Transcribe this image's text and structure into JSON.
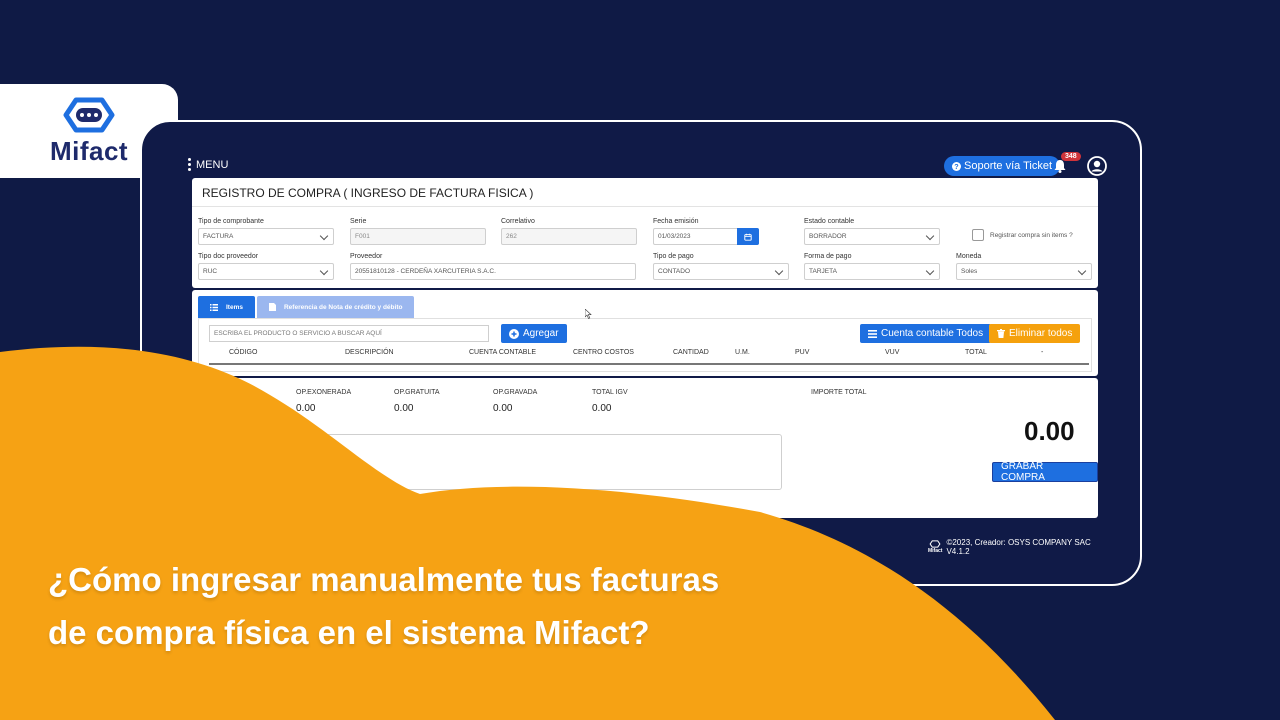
{
  "brand": {
    "name": "Mifact"
  },
  "topbar": {
    "menu_label": "MENU",
    "ticket_label": "Soporte vía Ticket",
    "notifications_count": "348"
  },
  "form": {
    "title": "REGISTRO DE COMPRA ( INGRESO DE FACTURA FISICA )",
    "tipo_comprobante": {
      "label": "Tipo de comprobante",
      "value": "FACTURA"
    },
    "serie": {
      "label": "Serie",
      "value": "F001"
    },
    "correlativo": {
      "label": "Correlativo",
      "value": "262"
    },
    "fecha_emision": {
      "label": "Fecha emisión",
      "value": "01/03/2023"
    },
    "estado_contable": {
      "label": "Estado contable",
      "value": "BORRADOR"
    },
    "registrar_sin_items": {
      "label": "Registrar compra sin items ?"
    },
    "tipo_doc_proveedor": {
      "label": "Tipo doc proveedor",
      "value": "RUC"
    },
    "proveedor": {
      "label": "Proveedor",
      "value": "20551810128 - CERDEÑA XARCUTERIA S.A.C."
    },
    "tipo_pago": {
      "label": "Tipo de pago",
      "value": "CONTADO"
    },
    "forma_pago": {
      "label": "Forma de pago",
      "value": "TARJETA"
    },
    "moneda": {
      "label": "Moneda",
      "value": "Soles"
    }
  },
  "items": {
    "tabs": [
      {
        "label": "Items"
      },
      {
        "label": "Referencia de Nota de crédito y débito"
      }
    ],
    "search_placeholder": "ESCRIBA EL PRODUCTO O SERVICIO A BUSCAR AQUÍ",
    "add_label": "Agregar",
    "cuenta_label": "Cuenta contable Todos",
    "eliminar_label": "Eliminar todos",
    "columns": [
      "CÓDIGO",
      "DESCRIPCIÓN",
      "CUENTA CONTABLE",
      "CENTRO COSTOS",
      "CANTIDAD",
      "U.M.",
      "PUV",
      "VUV",
      "TOTAL",
      "-"
    ]
  },
  "totals": {
    "exonerada": {
      "label": "OP.EXONERADA",
      "value": "0.00"
    },
    "gratuita": {
      "label": "OP.GRATUITA",
      "value": "0.00"
    },
    "gravada": {
      "label": "OP.GRAVADA",
      "value": "0.00"
    },
    "igv": {
      "label": "TOTAL IGV",
      "value": "0.00"
    },
    "importe": {
      "label": "IMPORTE TOTAL",
      "value": "0.00"
    },
    "save_label": "GRABAR COMPRA"
  },
  "footer": {
    "logo_text": "Mifact",
    "copyright": "©2023, Creador: OSYS COMPANY SAC V4.1.2"
  },
  "headline": {
    "line1": "¿Cómo ingresar manualmente tus facturas",
    "line2": "de compra física en el sistema Mifact?"
  },
  "colors": {
    "navy": "#0f1a45",
    "orange": "#f5a10d",
    "blue": "#1e6fe0"
  },
  "icons": [
    "menu-dots-icon",
    "help-icon",
    "bell-icon",
    "user-icon",
    "calendar-icon",
    "list-icon",
    "document-icon",
    "plus-icon",
    "bars-icon",
    "trash-icon",
    "chevron-down-icon"
  ]
}
